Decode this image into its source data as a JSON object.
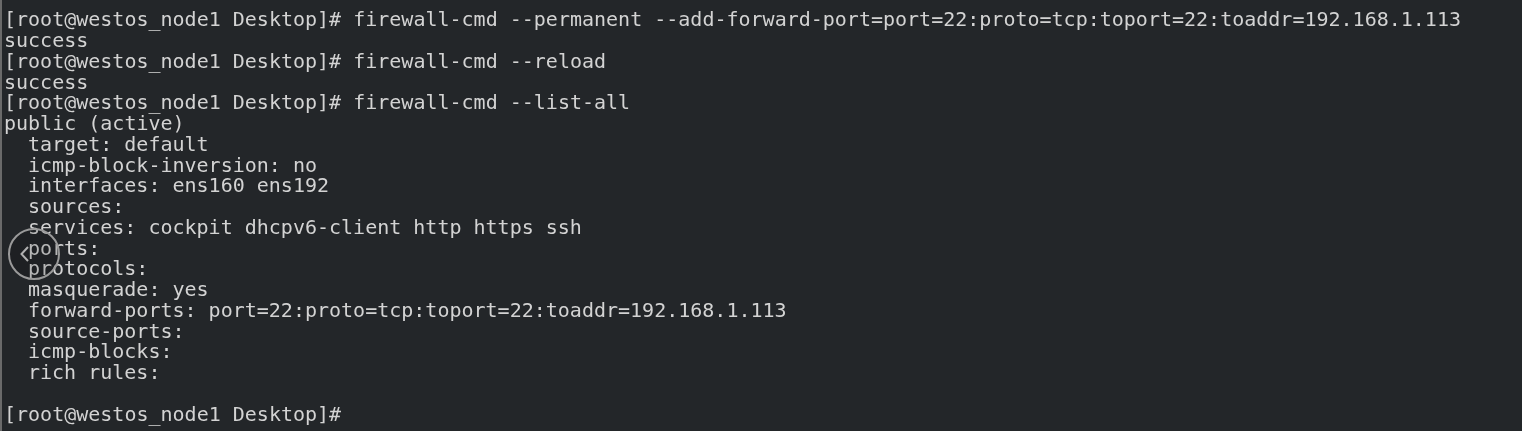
{
  "terminal": {
    "lines": [
      {
        "kind": "line",
        "text": "[root@westos_node1 Desktop]# firewall-cmd --permanent --add-forward-port=port=22:proto=tcp:toport=22:toaddr=192.168.1.113"
      },
      {
        "kind": "line",
        "text": "success"
      },
      {
        "kind": "line",
        "text": "[root@westos_node1 Desktop]# firewall-cmd --reload"
      },
      {
        "kind": "line",
        "text": "success"
      },
      {
        "kind": "line",
        "text": "[root@westos_node1 Desktop]# firewall-cmd --list-all"
      },
      {
        "kind": "line",
        "text": "public (active)",
        "children": [
          {
            "kind": "line",
            "text": "target: default"
          },
          {
            "kind": "line",
            "text": "icmp-block-inversion: no"
          },
          {
            "kind": "line",
            "text": "interfaces: ens160 ens192"
          },
          {
            "kind": "line",
            "text": "sources:"
          },
          {
            "kind": "line",
            "text": "services: cockpit dhcpv6-client http https ssh"
          },
          {
            "kind": "line",
            "text": "ports:"
          },
          {
            "kind": "line",
            "text": "protocols:"
          },
          {
            "kind": "line",
            "text": "masquerade: yes"
          },
          {
            "kind": "line",
            "text": "forward-ports: port=22:proto=tcp:toport=22:toaddr=192.168.1.113"
          },
          {
            "kind": "line",
            "text": "source-ports:"
          },
          {
            "kind": "line",
            "text": "icmp-blocks:"
          },
          {
            "kind": "line",
            "text": "rich rules:"
          }
        ]
      },
      {
        "kind": "blank"
      },
      {
        "kind": "line",
        "text": "[root@westos_node1 Desktop]#"
      }
    ]
  }
}
